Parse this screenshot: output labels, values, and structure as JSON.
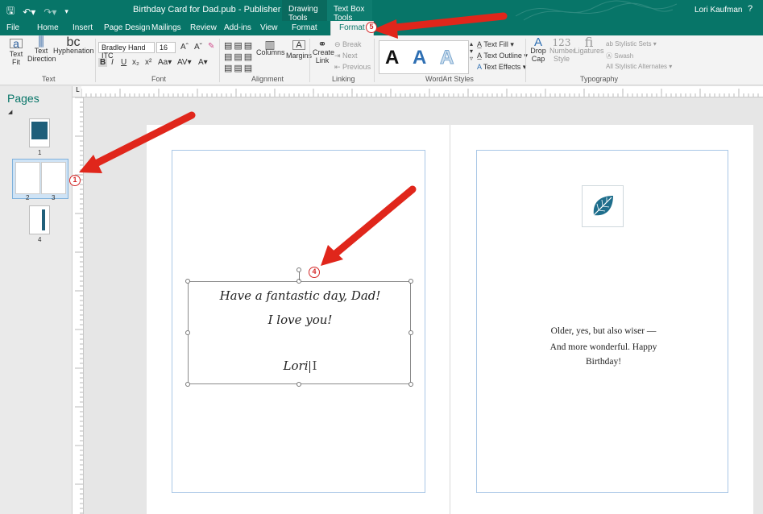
{
  "titlebar": {
    "document_title": "Birthday Card for Dad.pub - Publisher",
    "context_drawing": "Drawing Tools",
    "context_textbox": "Text Box Tools",
    "user": "Lori Kaufman",
    "help": "?"
  },
  "tabs": [
    "File",
    "Home",
    "Insert",
    "Page Design",
    "Mailings",
    "Review",
    "Add-ins",
    "View",
    "Format",
    "Format"
  ],
  "ribbon": {
    "text_group": {
      "text_fit": "Text",
      "text_fit2": "Fit",
      "text_direction": "Text",
      "text_direction2": "Direction",
      "hyphenation": "Hyphenation",
      "label": "Text"
    },
    "font_group": {
      "font_name": "Bradley Hand ITC",
      "font_size": "16",
      "label": "Font"
    },
    "alignment_group": {
      "columns": "Columns",
      "margins": "Margins",
      "label": "Alignment"
    },
    "linking_group": {
      "create_link": "Create",
      "create_link2": "Link",
      "break": "Break",
      "next": "Next",
      "previous": "Previous",
      "label": "Linking"
    },
    "wordart_group": {
      "sample": "A",
      "text_fill": "Text Fill",
      "text_outline": "Text Outline",
      "text_effects": "Text Effects",
      "label": "WordArt Styles"
    },
    "typography_group": {
      "drop_cap": "Drop",
      "drop_cap2": "Cap",
      "number_style": "Number",
      "number_style2": "Style",
      "ligatures": "Ligatures",
      "stylistic_sets": "Stylistic Sets",
      "swash": "Swash",
      "stylistic_alternates": "All Stylistic Alternates",
      "label": "Typography",
      "number_glyph": "123"
    }
  },
  "pages_pane": {
    "title": "Pages",
    "thumbs": [
      {
        "label": "1"
      },
      {
        "label": "2",
        "label_b": "3"
      },
      {
        "label": "4"
      }
    ]
  },
  "canvas": {
    "textbox_lines": [
      "Have a fantastic day, Dad!",
      "I love you!",
      "Lori"
    ],
    "verse_lines": [
      "Older, yes, but also wiser —",
      "And more wonderful.  Happy",
      "Birthday!"
    ]
  },
  "annotations": [
    "1",
    "4",
    "5"
  ],
  "colors": {
    "accent": "#077568",
    "arrow": "#e0261b"
  }
}
